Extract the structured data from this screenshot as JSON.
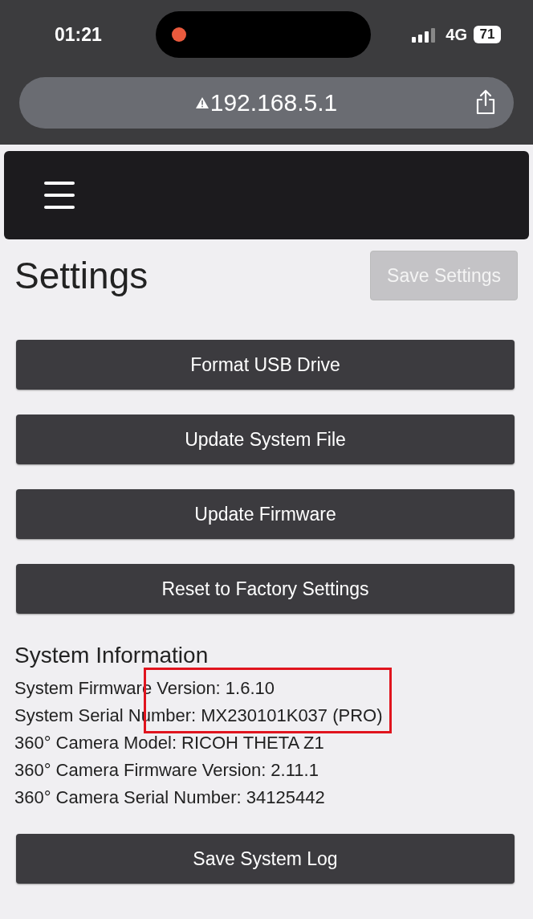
{
  "status_bar": {
    "time": "01:21",
    "recording": true,
    "network": "4G",
    "battery": "71"
  },
  "browser": {
    "address": "192.168.5.1",
    "insecure": true
  },
  "page": {
    "title": "Settings",
    "save_button": {
      "label": "Save Settings",
      "disabled": true
    },
    "actions": [
      "Format USB Drive",
      "Update System File",
      "Update Firmware",
      "Reset to Factory Settings"
    ],
    "system_information": {
      "heading": "System Information",
      "lines": [
        "System Firmware Version: 1.6.10",
        "System Serial Number: MX230101K037 (PRO)",
        "360° Camera Model: RICOH THETA Z1",
        "360° Camera Firmware Version: 2.11.1",
        "360° Camera Serial Number: 34125442"
      ]
    },
    "log_button": "Save System Log"
  }
}
